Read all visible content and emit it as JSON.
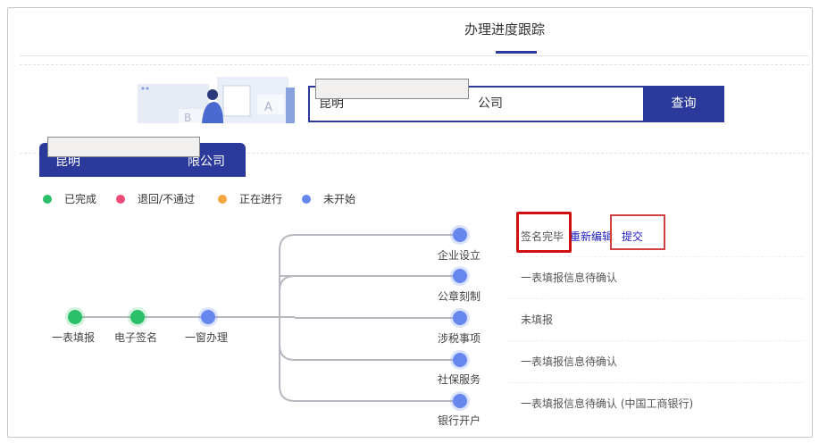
{
  "tab": {
    "label": "办理进度跟踪"
  },
  "search": {
    "value_prefix": "昆明",
    "value_suffix": "公司",
    "button": "查询"
  },
  "company": {
    "prefix": "昆明",
    "suffix": "限公司"
  },
  "legend": [
    {
      "label": "已完成",
      "color": "#2bbf6a"
    },
    {
      "label": "退回/不通过",
      "color": "#ee4a78"
    },
    {
      "label": "正在进行",
      "color": "#f5a742"
    },
    {
      "label": "未开始",
      "color": "#6688ee"
    }
  ],
  "main_steps": [
    {
      "label": "一表填报",
      "status": "已完成"
    },
    {
      "label": "电子签名",
      "status": "已完成"
    },
    {
      "label": "一窗办理",
      "status": "未开始"
    }
  ],
  "branches": [
    {
      "label": "企业设立",
      "status_text": "签名完毕",
      "actions": [
        "重新编辑",
        "提交"
      ]
    },
    {
      "label": "公章刻制",
      "status_text": "一表填报信息待确认"
    },
    {
      "label": "涉税事项",
      "status_text": "未填报"
    },
    {
      "label": "社保服务",
      "status_text": "一表填报信息待确认"
    },
    {
      "label": "银行开户",
      "status_text": "一表填报信息待确认 (中国工商银行)"
    }
  ]
}
